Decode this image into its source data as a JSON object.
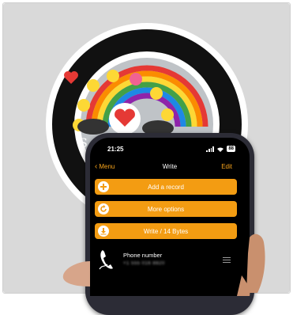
{
  "status_bar": {
    "time": "21:25",
    "battery": "88"
  },
  "nav": {
    "back_label": "Menu",
    "title": "Write",
    "edit_label": "Edit"
  },
  "buttons": [
    {
      "label": "Add a record",
      "icon": "plus-icon"
    },
    {
      "label": "More options",
      "icon": "refresh-icon"
    },
    {
      "label": "Write / 14 Bytes",
      "icon": "download-icon"
    }
  ],
  "record": {
    "title": "Phone number",
    "value": "+1 555 016 8820",
    "icon": "phone-icon"
  },
  "colors": {
    "accent": "#f39c12",
    "background": "#d9d9d9",
    "screen": "#000000"
  }
}
